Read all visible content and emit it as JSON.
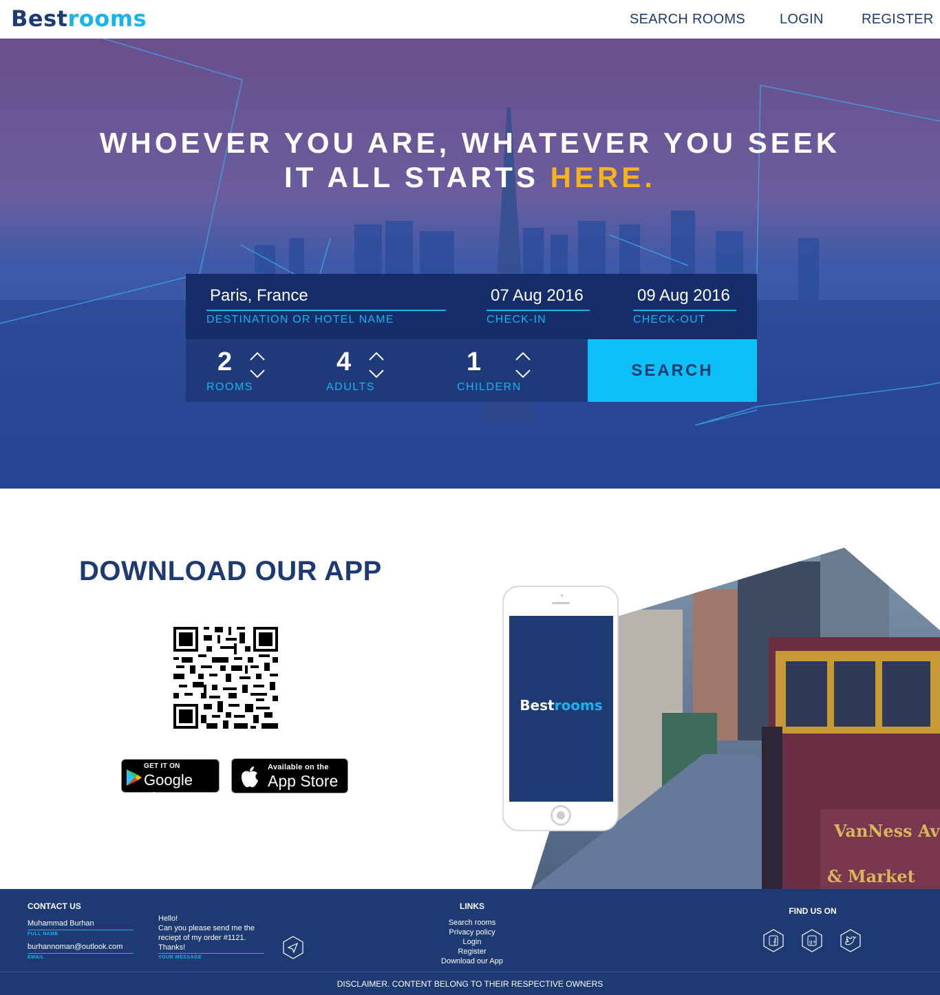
{
  "brand": {
    "name_part1": "Best",
    "name_part2": "rooms"
  },
  "nav": {
    "items": [
      "SEARCH ROOMS",
      "LOGIN",
      "REGISTER"
    ]
  },
  "hero": {
    "line1": "WHOEVER YOU ARE, WHATEVER YOU SEEK",
    "line2_prefix": "IT ALL STARTS ",
    "line2_highlight": "HERE."
  },
  "search": {
    "destination": {
      "value": "Paris, France",
      "label": "DESTINATION OR HOTEL NAME"
    },
    "checkin": {
      "value": "07 Aug 2016",
      "label": "CHECK-IN"
    },
    "checkout": {
      "value": "09 Aug 2016",
      "label": "CHECK-OUT"
    },
    "rooms": {
      "value": "2",
      "label": "ROOMS"
    },
    "adults": {
      "value": "4",
      "label": "ADULTS"
    },
    "children": {
      "value": "1",
      "label": "CHILDERN"
    },
    "button": "SEARCH"
  },
  "app": {
    "title": "DOWNLOAD OUR APP",
    "google_play": {
      "line1": "GET IT ON",
      "line2": "Google play"
    },
    "app_store": {
      "line1": "Available on the",
      "line2": "App Store"
    }
  },
  "footer": {
    "contact_title": "CONTACT US",
    "name": {
      "value": "Muhammad Burhan",
      "label": "FULL NAME"
    },
    "email": {
      "value": "burhannoman@outlook.com",
      "label": "EMAIL"
    },
    "message": {
      "lines": [
        "Hello!",
        "Can you please send me the",
        "reciept of my order #1121.",
        "Thanks!"
      ],
      "label": "YOUR MESSAGE"
    },
    "links_title": "LINKS",
    "links": [
      "Search rooms",
      "Privacy policy",
      "Login",
      "Register",
      "Download our App"
    ],
    "find_title": "FIND US ON",
    "social_icons": [
      "facebook-icon",
      "google-plus-icon",
      "twitter-icon"
    ],
    "disclaimer": "DISCLAIMER. CONTENT BELONG TO THEIR RESPECTIVE OWNERS"
  },
  "colors": {
    "navy": "#1e3a72",
    "accent": "#16b4ee",
    "highlight": "#f8b21c",
    "button": "#0cc0f5"
  }
}
